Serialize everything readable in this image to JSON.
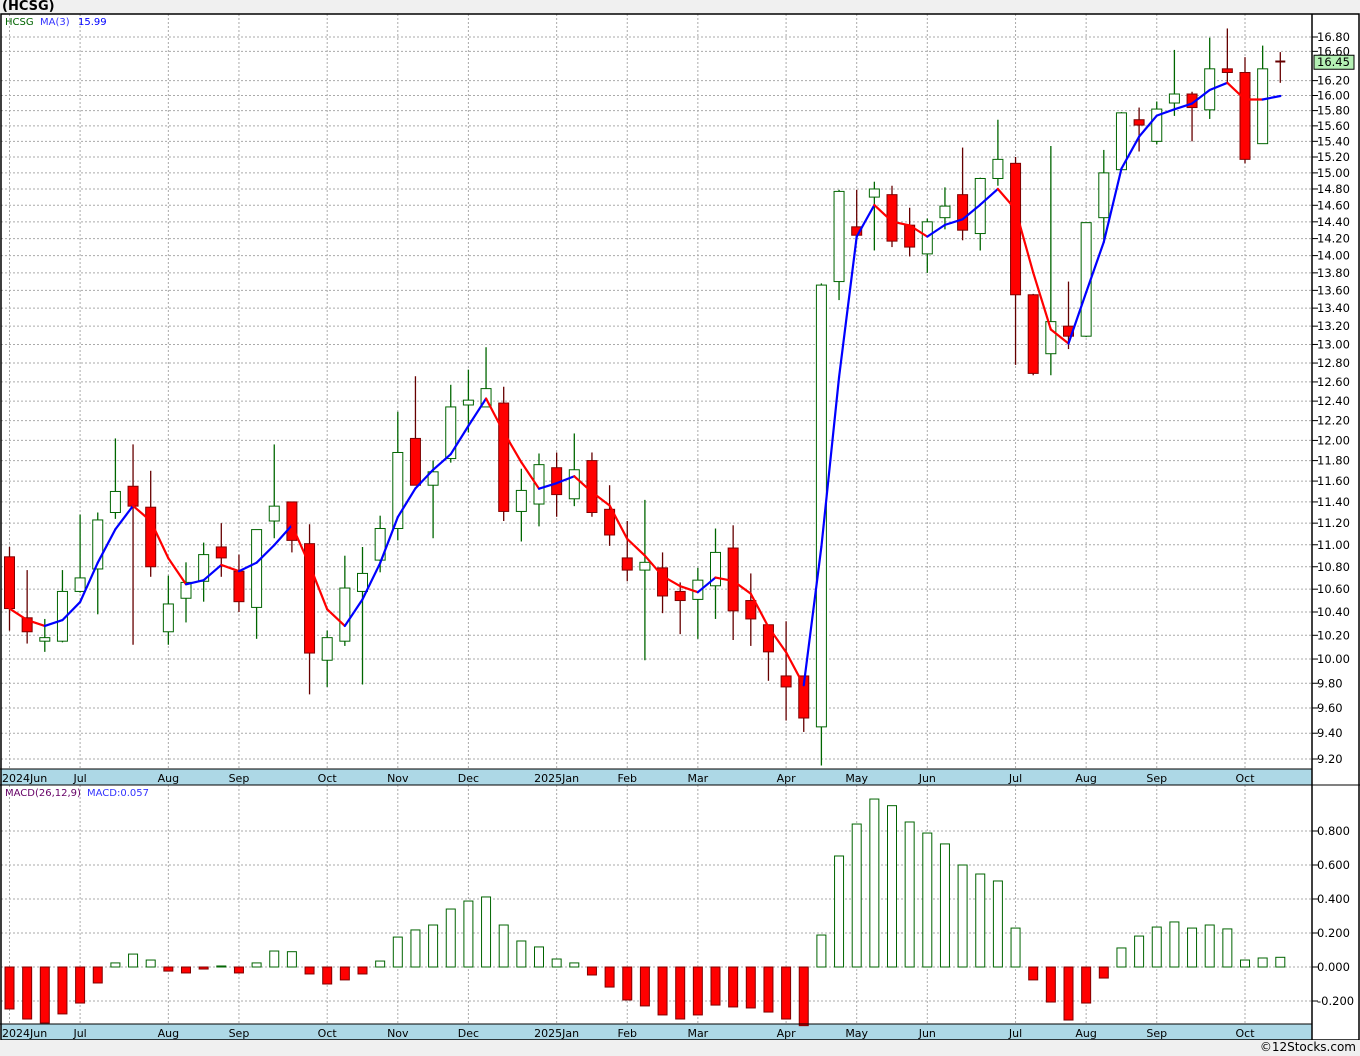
{
  "title": "(HCSG)",
  "legend": {
    "symbol": "HCSG",
    "ma_label": "MA(3)",
    "ma_value": "15.99"
  },
  "last_price_label": "16.45",
  "macd_legend": {
    "label": "MACD(26,12,9)",
    "value": "MACD:0.057"
  },
  "copyright": "©12Stocks.com",
  "colors": {
    "up_border": "#006400",
    "down_fill": "#ff0000",
    "down_border": "#800000",
    "ma_up": "#0000ff",
    "ma_down": "#ff0000",
    "date_strip": "#add8e6",
    "last_price_box": "#b4f0b4"
  },
  "months": [
    "2024Jun",
    "Jul",
    "Aug",
    "Sep",
    "Oct",
    "Nov",
    "Dec",
    "2025Jan",
    "Feb",
    "Mar",
    "Apr",
    "May",
    "Jun",
    "Jul",
    "Aug",
    "Sep",
    "Oct"
  ],
  "chart_data": [
    {
      "type": "candlestick",
      "frequency": "weekly",
      "scale": "log",
      "ylim": [
        9.2,
        16.8
      ],
      "grid": true,
      "y_ticks": [
        "16.80",
        "16.60",
        "16.20",
        "16.00",
        "15.80",
        "15.60",
        "15.40",
        "15.20",
        "15.00",
        "14.80",
        "14.60",
        "14.40",
        "14.20",
        "14.00",
        "13.80",
        "13.60",
        "13.40",
        "13.20",
        "13.00",
        "12.80",
        "12.60",
        "12.40",
        "12.20",
        "12.00",
        "11.80",
        "11.60",
        "11.40",
        "11.20",
        "11.00",
        "10.80",
        "10.60",
        "10.40",
        "10.20",
        "10.00",
        "9.80",
        "9.60",
        "9.40",
        "9.20"
      ],
      "overlay": "MA(3)",
      "ohlc": [
        [
          10.89,
          10.98,
          10.24,
          10.43
        ],
        [
          10.35,
          10.77,
          10.13,
          10.23
        ],
        [
          10.15,
          10.34,
          10.06,
          10.18
        ],
        [
          10.15,
          10.77,
          10.14,
          10.58
        ],
        [
          10.58,
          11.28,
          10.57,
          10.7
        ],
        [
          10.78,
          11.3,
          10.38,
          11.23
        ],
        [
          11.3,
          12.02,
          11.24,
          11.5
        ],
        [
          11.55,
          11.96,
          10.12,
          11.36
        ],
        [
          11.35,
          11.7,
          10.71,
          10.8
        ],
        [
          10.23,
          10.72,
          10.12,
          10.47
        ],
        [
          10.52,
          10.84,
          10.31,
          10.66
        ],
        [
          10.67,
          11.02,
          10.49,
          10.91
        ],
        [
          10.98,
          11.2,
          10.71,
          10.88
        ],
        [
          10.76,
          10.91,
          10.4,
          10.49
        ],
        [
          10.44,
          11.14,
          10.17,
          11.14
        ],
        [
          11.22,
          11.96,
          11.06,
          11.36
        ],
        [
          11.4,
          11.4,
          10.93,
          11.04
        ],
        [
          11.01,
          11.19,
          9.71,
          10.05
        ],
        [
          9.99,
          10.24,
          9.77,
          10.18
        ],
        [
          10.15,
          10.9,
          10.11,
          10.61
        ],
        [
          10.58,
          10.98,
          9.79,
          10.74
        ],
        [
          10.86,
          11.27,
          10.75,
          11.15
        ],
        [
          11.15,
          12.29,
          11.04,
          11.88
        ],
        [
          12.02,
          12.66,
          11.56,
          11.56
        ],
        [
          11.56,
          11.8,
          11.06,
          11.69
        ],
        [
          11.82,
          12.57,
          11.78,
          12.34
        ],
        [
          12.36,
          12.73,
          12.08,
          12.41
        ],
        [
          12.34,
          12.97,
          12.34,
          12.53
        ],
        [
          12.38,
          12.55,
          11.22,
          11.31
        ],
        [
          11.31,
          11.72,
          11.03,
          11.51
        ],
        [
          11.38,
          11.87,
          11.17,
          11.76
        ],
        [
          11.73,
          11.88,
          11.26,
          11.47
        ],
        [
          11.43,
          12.07,
          11.36,
          11.71
        ],
        [
          11.8,
          11.88,
          11.26,
          11.3
        ],
        [
          11.33,
          11.56,
          10.99,
          11.09
        ],
        [
          10.88,
          11.22,
          10.67,
          10.77
        ],
        [
          10.77,
          11.42,
          9.99,
          10.84
        ],
        [
          10.79,
          10.93,
          10.39,
          10.54
        ],
        [
          10.58,
          10.66,
          10.21,
          10.5
        ],
        [
          10.51,
          10.79,
          10.17,
          10.68
        ],
        [
          10.63,
          11.15,
          10.34,
          10.93
        ],
        [
          10.97,
          11.18,
          10.16,
          10.41
        ],
        [
          10.5,
          10.74,
          10.11,
          10.34
        ],
        [
          10.29,
          10.29,
          9.82,
          10.06
        ],
        [
          9.86,
          10.32,
          9.5,
          9.77
        ],
        [
          9.86,
          9.86,
          9.41,
          9.52
        ],
        [
          9.45,
          13.68,
          9.15,
          13.66
        ],
        [
          13.7,
          14.79,
          13.49,
          14.77
        ],
        [
          14.34,
          14.79,
          14.24,
          14.24
        ],
        [
          14.7,
          14.89,
          14.06,
          14.8
        ],
        [
          14.73,
          14.84,
          14.1,
          14.17
        ],
        [
          14.36,
          14.57,
          13.99,
          14.1
        ],
        [
          14.02,
          14.44,
          13.8,
          14.4
        ],
        [
          14.45,
          14.82,
          14.31,
          14.59
        ],
        [
          14.73,
          15.32,
          14.18,
          14.3
        ],
        [
          14.26,
          14.94,
          14.06,
          14.93
        ],
        [
          14.93,
          15.68,
          14.84,
          15.17
        ],
        [
          15.12,
          15.2,
          12.78,
          13.55
        ],
        [
          13.55,
          13.56,
          12.67,
          12.69
        ],
        [
          12.9,
          15.34,
          12.67,
          13.25
        ],
        [
          13.2,
          13.7,
          12.95,
          13.09
        ],
        [
          13.09,
          14.39,
          13.08,
          14.39
        ],
        [
          14.45,
          15.29,
          14.18,
          15.0
        ],
        [
          15.04,
          15.78,
          15.04,
          15.77
        ],
        [
          15.68,
          15.84,
          15.27,
          15.61
        ],
        [
          15.4,
          15.92,
          15.36,
          15.82
        ],
        [
          15.9,
          16.62,
          15.73,
          16.02
        ],
        [
          16.02,
          16.05,
          15.4,
          15.84
        ],
        [
          15.81,
          16.79,
          15.69,
          16.36
        ],
        [
          16.36,
          16.92,
          16.18,
          16.31
        ],
        [
          16.31,
          16.52,
          15.12,
          15.17
        ],
        [
          15.37,
          16.68,
          15.37,
          16.36
        ],
        [
          16.46,
          16.59,
          16.17,
          16.45
        ]
      ]
    },
    {
      "type": "bar",
      "title": "MACD(26,12,9)",
      "ylim": [
        -0.34,
        1.0
      ],
      "y_ticks": [
        "0.800",
        "0.600",
        "0.400",
        "0.200",
        "0.000",
        "-0.200"
      ],
      "grid": true,
      "values": [
        -0.247,
        -0.306,
        -0.329,
        -0.276,
        -0.212,
        -0.094,
        0.024,
        0.076,
        0.041,
        -0.024,
        -0.035,
        -0.012,
        0.006,
        -0.035,
        0.024,
        0.094,
        0.09,
        -0.041,
        -0.1,
        -0.076,
        -0.041,
        0.035,
        0.176,
        0.218,
        0.247,
        0.341,
        0.388,
        0.412,
        0.247,
        0.153,
        0.118,
        0.047,
        0.024,
        -0.047,
        -0.118,
        -0.194,
        -0.229,
        -0.282,
        -0.306,
        -0.282,
        -0.224,
        -0.235,
        -0.241,
        -0.265,
        -0.306,
        -0.345,
        0.188,
        0.653,
        0.841,
        0.988,
        0.949,
        0.853,
        0.788,
        0.724,
        0.6,
        0.547,
        0.506,
        0.229,
        -0.076,
        -0.206,
        -0.312,
        -0.212,
        -0.065,
        0.112,
        0.182,
        0.235,
        0.265,
        0.229,
        0.247,
        0.224,
        0.041,
        0.053,
        0.057
      ]
    }
  ]
}
